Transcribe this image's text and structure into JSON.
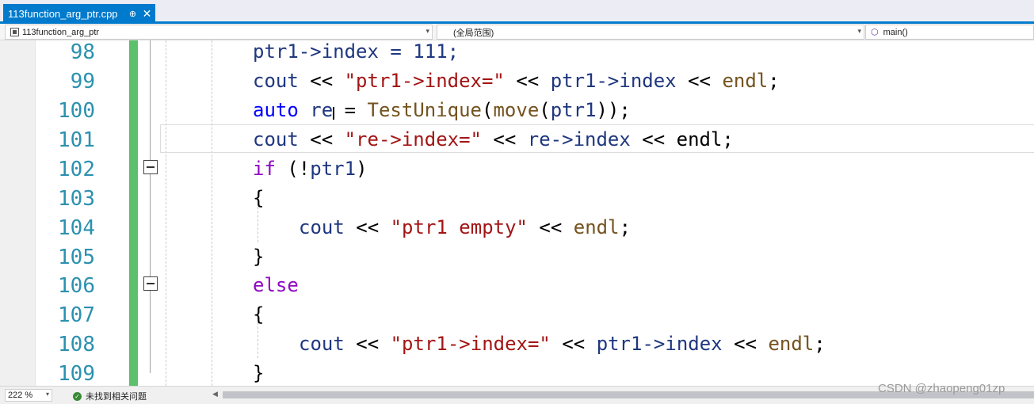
{
  "tab": {
    "title": "113function_arg_ptr.cpp",
    "pin": "⊕",
    "close": "✕"
  },
  "nav": {
    "project": "113function_arg_ptr",
    "scope": "(全局范围)",
    "function": "main()"
  },
  "lines": [
    {
      "num": "98",
      "tokens": [
        "ptr1->index = 111;"
      ]
    },
    {
      "num": "99",
      "tokens": [
        "cout",
        " << ",
        "\"ptr1->index=\"",
        " << ",
        "ptr1->index",
        " << ",
        "endl",
        ";"
      ]
    },
    {
      "num": "100",
      "tokens": [
        "auto",
        " re",
        " = ",
        "TestUnique",
        "(",
        "move",
        "(",
        "ptr1",
        "));"
      ]
    },
    {
      "num": "101",
      "tokens": [
        "cout",
        " << ",
        "\"re->index=\"",
        " << ",
        "re->index",
        " << ",
        "endl;"
      ]
    },
    {
      "num": "102",
      "tokens": [
        "if",
        " (!",
        "ptr1",
        ")"
      ]
    },
    {
      "num": "103",
      "tokens": [
        "{"
      ]
    },
    {
      "num": "104",
      "tokens": [
        "cout",
        " << ",
        "\"ptr1 empty\"",
        " << ",
        "endl",
        ";"
      ]
    },
    {
      "num": "105",
      "tokens": [
        "}"
      ]
    },
    {
      "num": "106",
      "tokens": [
        "else"
      ]
    },
    {
      "num": "107",
      "tokens": [
        "{"
      ]
    },
    {
      "num": "108",
      "tokens": [
        "cout",
        " << ",
        "\"ptr1->index=\"",
        " << ",
        "ptr1->index",
        " << ",
        "endl",
        ";"
      ]
    },
    {
      "num": "109",
      "tokens": [
        "}"
      ]
    }
  ],
  "status": {
    "zoom": "222 %",
    "issues": "未找到相关问题"
  },
  "watermark": "CSDN @zhaopeng01zp",
  "colors": {
    "accent": "#007acc",
    "keyword": "#0000ff",
    "control": "#8f08c4",
    "string": "#a31515",
    "line_number": "#2b91af",
    "change_bar": "#5cc06c"
  }
}
